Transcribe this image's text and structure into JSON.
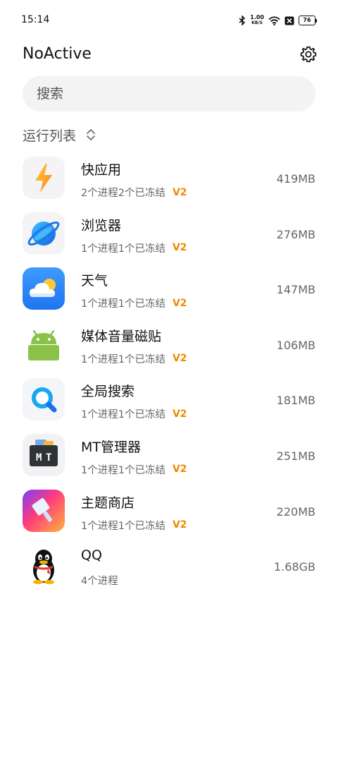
{
  "status_bar": {
    "time": "15:14",
    "speed_value": "1.00",
    "speed_unit": "KB/S",
    "battery": "76"
  },
  "header": {
    "title": "NoActive"
  },
  "search": {
    "placeholder": "搜索"
  },
  "list_header": {
    "label": "运行列表"
  },
  "apps": [
    {
      "name": "快应用",
      "processes": "2个进程2个已冻结",
      "badge": "V2",
      "memory": "419MB",
      "icon": "quick-app-icon"
    },
    {
      "name": "浏览器",
      "processes": "1个进程1个已冻结",
      "badge": "V2",
      "memory": "276MB",
      "icon": "browser-icon"
    },
    {
      "name": "天气",
      "processes": "1个进程1个已冻结",
      "badge": "V2",
      "memory": "147MB",
      "icon": "weather-icon"
    },
    {
      "name": "媒体音量磁贴",
      "processes": "1个进程1个已冻结",
      "badge": "V2",
      "memory": "106MB",
      "icon": "android-icon"
    },
    {
      "name": "全局搜索",
      "processes": "1个进程1个已冻结",
      "badge": "V2",
      "memory": "181MB",
      "icon": "global-search-icon"
    },
    {
      "name": "MT管理器",
      "processes": "1个进程1个已冻结",
      "badge": "V2",
      "memory": "251MB",
      "icon": "mt-manager-icon"
    },
    {
      "name": "主题商店",
      "processes": "1个进程1个已冻结",
      "badge": "V2",
      "memory": "220MB",
      "icon": "theme-store-icon"
    },
    {
      "name": "QQ",
      "processes": "4个进程",
      "badge": "",
      "memory": "1.68GB",
      "icon": "qq-icon"
    }
  ],
  "colors": {
    "badge": "#f08a00",
    "search_bg": "#f3f3f3"
  }
}
